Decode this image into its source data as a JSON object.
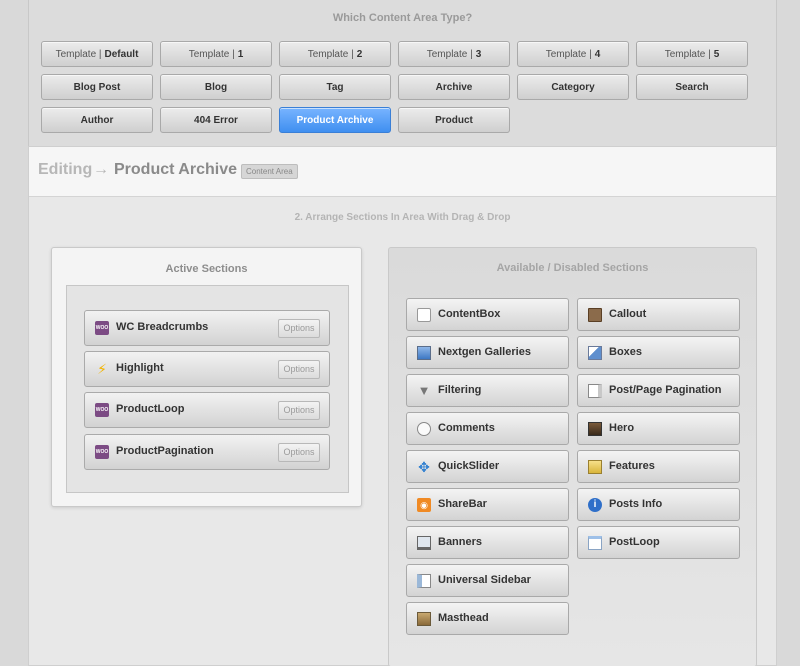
{
  "top": {
    "title": "Which Content Area Type?",
    "templates": [
      {
        "prefix": "Template |",
        "label": "Default"
      },
      {
        "prefix": "Template |",
        "label": "1"
      },
      {
        "prefix": "Template |",
        "label": "2"
      },
      {
        "prefix": "Template |",
        "label": "3"
      },
      {
        "prefix": "Template |",
        "label": "4"
      },
      {
        "prefix": "Template |",
        "label": "5"
      }
    ],
    "types_row2": [
      "Blog Post",
      "Blog",
      "Tag",
      "Archive",
      "Category",
      "Search"
    ],
    "types_row3": [
      "Author",
      "404 Error",
      "Product Archive",
      "Product"
    ],
    "active_type": "Product Archive"
  },
  "editing": {
    "prefix": "Editing",
    "arrow": "→",
    "name": "Product Archive",
    "badge": "Content Area",
    "arrange_title": "2. Arrange Sections In Area With Drag & Drop"
  },
  "active_sections": {
    "title": "Active Sections",
    "options_label": "Options",
    "items": [
      {
        "label": "WC Breadcrumbs",
        "icon": "woocommerce-icon"
      },
      {
        "label": "Highlight",
        "icon": "lightning-icon"
      },
      {
        "label": "ProductLoop",
        "icon": "woocommerce-icon"
      },
      {
        "label": "ProductPagination",
        "icon": "woocommerce-icon"
      }
    ]
  },
  "available_sections": {
    "title": "Available / Disabled Sections",
    "left": [
      {
        "label": "ContentBox",
        "icon": "content-box-icon"
      },
      {
        "label": "Nextgen Galleries",
        "icon": "gallery-icon"
      },
      {
        "label": "Filtering",
        "icon": "funnel-icon"
      },
      {
        "label": "Comments",
        "icon": "comment-bubble-icon"
      },
      {
        "label": "QuickSlider",
        "icon": "slider-icon"
      },
      {
        "label": "ShareBar",
        "icon": "rss-icon"
      },
      {
        "label": "Banners",
        "icon": "monitor-icon"
      },
      {
        "label": "Universal Sidebar",
        "icon": "sidebar-layout-icon"
      },
      {
        "label": "Masthead",
        "icon": "masthead-image-icon"
      }
    ],
    "right": [
      {
        "label": "Callout",
        "icon": "callout-icon"
      },
      {
        "label": "Boxes",
        "icon": "boxes-icon"
      },
      {
        "label": "Post/Page Pagination",
        "icon": "pagination-icon"
      },
      {
        "label": "Hero",
        "icon": "hero-icon"
      },
      {
        "label": "Features",
        "icon": "features-icon"
      },
      {
        "label": "Posts Info",
        "icon": "info-icon"
      },
      {
        "label": "PostLoop",
        "icon": "document-icon"
      }
    ]
  }
}
